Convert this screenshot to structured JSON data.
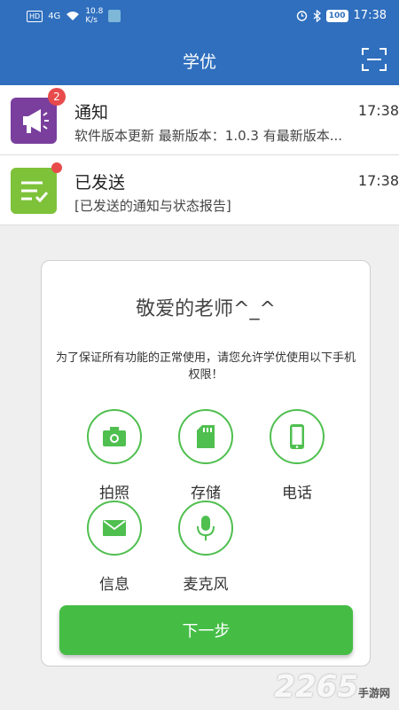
{
  "status_bar": {
    "hd": "HD",
    "network": "4G",
    "speed_value": "10.8",
    "speed_unit": "K/s",
    "battery": "100",
    "time": "17:38"
  },
  "app_bar": {
    "title": "学优",
    "scan_icon": "scan-icon"
  },
  "messages": [
    {
      "title": "通知",
      "subtitle": "软件版本更新 最新版本：1.0.3 有最新版本...",
      "time": "17:38",
      "badge": "2",
      "icon": "megaphone-icon",
      "color": "#7a3f9d"
    },
    {
      "title": "已发送",
      "subtitle": "[已发送的通知与状态报告]",
      "time": "17:38",
      "icon": "sent-list-icon",
      "color": "#7ec23a"
    }
  ],
  "dialog": {
    "title": "敬爱的老师^_^",
    "text": "为了保证所有功能的正常使用，请您允许学优使用以下手机权限！",
    "permissions": [
      {
        "label": "拍照",
        "icon": "camera-icon"
      },
      {
        "label": "存储",
        "icon": "sd-card-icon"
      },
      {
        "label": "电话",
        "icon": "phone-icon"
      },
      {
        "label": "信息",
        "icon": "mail-icon"
      },
      {
        "label": "麦克风",
        "icon": "microphone-icon"
      }
    ],
    "next_label": "下一步"
  },
  "watermark": {
    "brand": "2265",
    "suffix": "手游网"
  },
  "colors": {
    "primary": "#2f6fbe",
    "accent": "#45bd45"
  }
}
